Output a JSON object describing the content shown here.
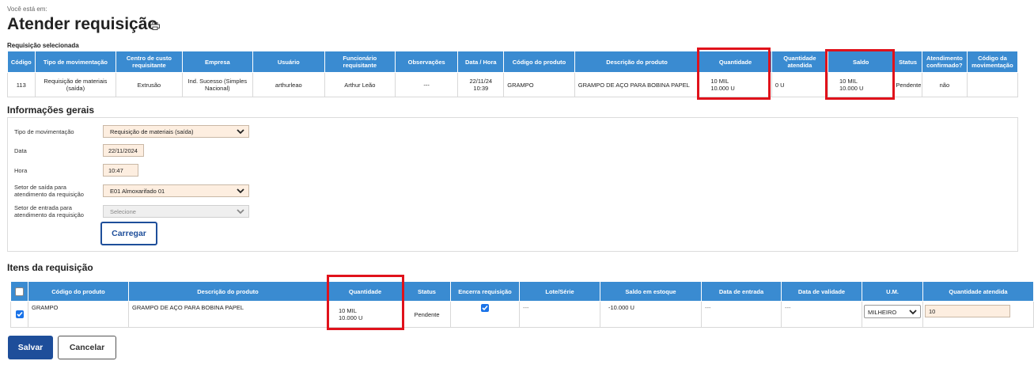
{
  "breadcrumb": "Você está em:",
  "page_title": "Atender requisição",
  "selected_label": "Requisição selecionada",
  "req_table": {
    "headers": [
      "Código",
      "Tipo de movimentação",
      "Centro de custo requisitante",
      "Empresa",
      "Usuário",
      "Funcionário requisitante",
      "Observações",
      "Data / Hora",
      "Código do produto",
      "Descrição do produto",
      "Quantidade",
      "Quantidade atendida",
      "Saldo",
      "Status",
      "Atendimento confirmado?",
      "Código da movimentação"
    ],
    "row": {
      "codigo": "113",
      "tipo": "Requisição de materiais (saída)",
      "centro": "Extrusão",
      "empresa": "Ind. Sucesso (Simples Nacional)",
      "usuario": "arthurleao",
      "funcionario": "Arthur Leão",
      "observacoes": "---",
      "data": "22/11/24",
      "hora": "10:39",
      "cod_produto": "GRAMPO",
      "descricao": "GRAMPO DE AÇO PARA BOBINA PAPEL",
      "qtd_line1": "10 MIL",
      "qtd_line2": "10.000 U",
      "qtd_atendida": "0 U",
      "saldo_line1": "10 MIL",
      "saldo_line2": "10.000 U",
      "status": "Pendente",
      "confirmado": "não",
      "cod_mov": ""
    }
  },
  "general": {
    "title": "Informações gerais",
    "tipo_label": "Tipo de movimentação",
    "tipo_value": "Requisição de materiais (saída)",
    "data_label": "Data",
    "data_value": "22/11/2024",
    "hora_label": "Hora",
    "hora_value": "10:47",
    "setor_saida_label_1": "Setor de saída para",
    "setor_saida_label_2": "atendimento da requisição",
    "setor_saida_value": "E01 Almoxarifado 01",
    "setor_entrada_label_1": "Setor de entrada para",
    "setor_entrada_label_2": "atendimento da requisição",
    "setor_entrada_value": "Selecione",
    "carregar": "Carregar"
  },
  "items": {
    "title": "Itens da requisição",
    "headers": [
      "Código do produto",
      "Descrição do produto",
      "Quantidade",
      "Status",
      "Encerra requisição",
      "Lote/Série",
      "Saldo em estoque",
      "Data de entrada",
      "Data de validade",
      "U.M.",
      "Quantidade atendida"
    ],
    "row": {
      "cod_produto": "GRAMPO",
      "descricao": "GRAMPO DE AÇO PARA BOBINA PAPEL",
      "qtd_line1": "10 MIL",
      "qtd_line2": "10.000 U",
      "status": "Pendente",
      "lote": "---",
      "saldo": "-10.000 U",
      "data_entrada": "---",
      "data_validade": "---",
      "um": "MILHEIRO",
      "qtd_atendida": "10"
    }
  },
  "buttons": {
    "salvar": "Salvar",
    "cancelar": "Cancelar"
  },
  "colors": {
    "header_blue": "#3a8bd1",
    "primary": "#1e4e9a",
    "highlight": "#e0121b",
    "input_bg": "#fdeee0"
  },
  "icons": [
    "print-icon",
    "chevron-down-icon",
    "check-icon"
  ]
}
